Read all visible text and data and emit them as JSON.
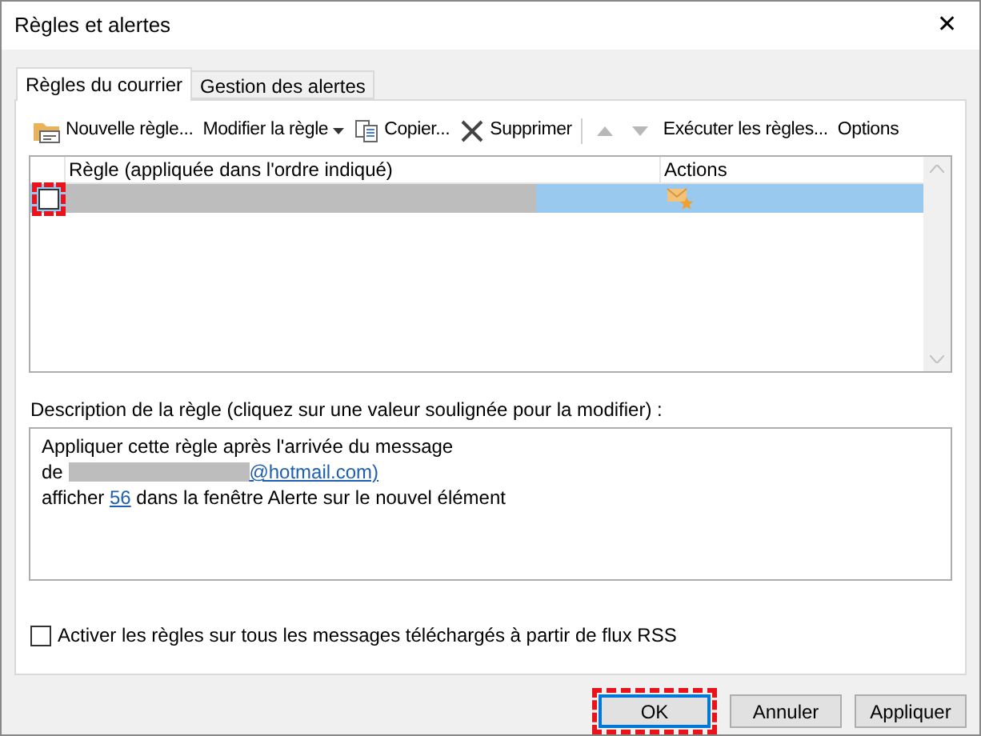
{
  "window": {
    "title": "Règles et alertes",
    "close": "✕"
  },
  "tabs": [
    {
      "label": "Règles du courrier",
      "selected": true
    },
    {
      "label": "Gestion des alertes",
      "selected": false
    }
  ],
  "toolbar": [
    {
      "kind": "new",
      "label": "Nouvelle règle...",
      "disabled": false
    },
    {
      "kind": "dropdown",
      "label": "Modifier la règle",
      "disabled": false
    },
    {
      "kind": "copy",
      "label": "Copier...",
      "disabled": false
    },
    {
      "kind": "delete",
      "label": "Supprimer",
      "disabled": false
    },
    {
      "kind": "up",
      "disabled": true
    },
    {
      "kind": "down",
      "disabled": true
    },
    {
      "kind": "text",
      "label": "Exécuter les règles...",
      "disabled": false
    },
    {
      "kind": "text",
      "label": "Options",
      "disabled": false
    }
  ],
  "table": {
    "columns": [
      "Règle (appliquée dans l'ordre indiqué)",
      "Actions"
    ],
    "rows": [
      {
        "checked": false,
        "selected": true,
        "highlighted": true,
        "redacted": true
      }
    ]
  },
  "description": {
    "label": "Description de la règle (cliquez sur une valeur soulignée pour la modifier) :",
    "lines": [
      [
        {
          "kind": "text",
          "text": "Appliquer cette règle après l'arrivée du message"
        }
      ],
      [
        {
          "kind": "text",
          "text": "de "
        },
        {
          "kind": "redacted"
        },
        {
          "kind": "link",
          "text": "@hotmail.com)"
        }
      ],
      [
        {
          "kind": "text",
          "text": "afficher "
        },
        {
          "kind": "link",
          "text": "56"
        },
        {
          "kind": "text",
          "text": " dans la fenêtre Alerte sur le nouvel élément"
        }
      ]
    ]
  },
  "rss": {
    "label": "Activer les règles sur tous les messages téléchargés à partir de flux RSS",
    "checked": false
  },
  "buttons": [
    {
      "label": "OK",
      "default": true,
      "highlighted": true
    },
    {
      "label": "Annuler",
      "default": false,
      "highlighted": false
    },
    {
      "label": "Appliquer",
      "default": false,
      "highlighted": false
    }
  ]
}
